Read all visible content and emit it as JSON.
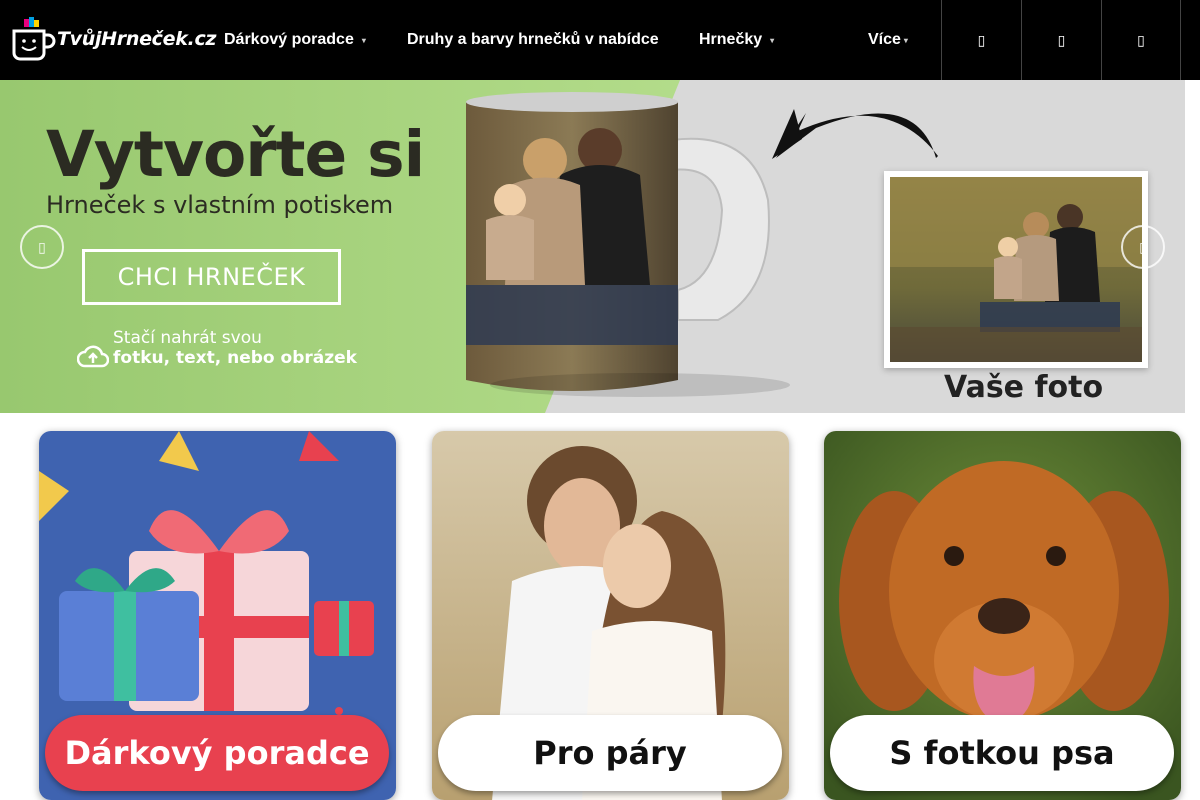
{
  "header": {
    "logo_text": "TvůjHrneček.cz",
    "nav": [
      {
        "label": "Dárkový poradce",
        "has_caret": true
      },
      {
        "label": "Druhy a barvy hrnečků v nabídce",
        "has_caret": false
      },
      {
        "label": "Hrnečky",
        "has_caret": true
      },
      {
        "label": "Více",
        "has_caret": true
      }
    ],
    "caret_glyph": "▾",
    "icon_glyph": "▯",
    "icons": [
      "search-icon",
      "user-icon",
      "cart-icon"
    ]
  },
  "banner": {
    "headline": "Vytvořte si",
    "subline_bold": "Hrneček",
    "subline_rest": " s vlastním potiskem",
    "cta": "CHCI HRNEČEK",
    "note_line1": "Stačí nahrát svou",
    "note_line2": "fotku, text, nebo obrázek",
    "photo_caption": "Vaše foto",
    "arrow_glyph": "▯",
    "colors": {
      "green": "#a8d37e",
      "grey": "#d9d9d9"
    }
  },
  "cards": [
    {
      "label": "Dárkový poradce",
      "label_bg": "#e8414f",
      "label_color": "#ffffff",
      "image": "gift-boxes"
    },
    {
      "label": "Pro páry",
      "label_bg": "#ffffff",
      "label_color": "#111111",
      "image": "couple-photo"
    },
    {
      "label": "S fotkou psa",
      "label_bg": "#ffffff",
      "label_color": "#111111",
      "image": "dog-photo"
    }
  ]
}
